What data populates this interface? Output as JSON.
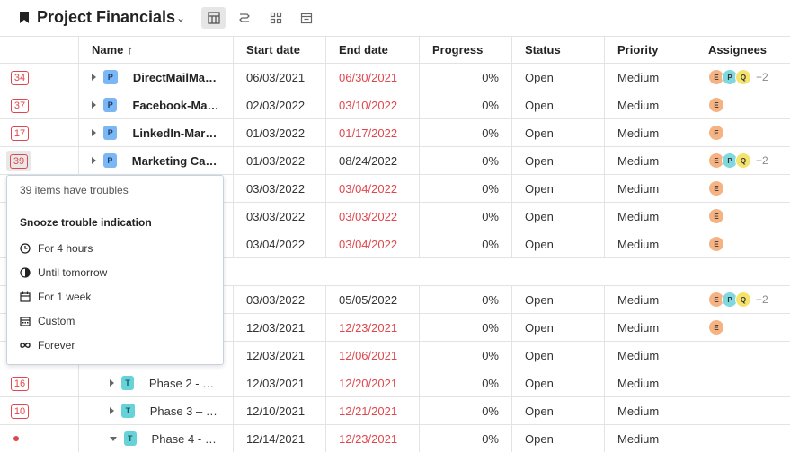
{
  "header": {
    "title": "Project Financials"
  },
  "columns": {
    "name": "Name",
    "start": "Start date",
    "end": "End date",
    "progress": "Progress",
    "status": "Status",
    "priority": "Priority",
    "assignees": "Assignees"
  },
  "rows": [
    {
      "trouble": "34",
      "name": "DirectMailMar…",
      "tag": "P",
      "start": "06/03/2021",
      "end": "06/30/2021",
      "progress": "0%",
      "status": "Open",
      "priority": "Medium",
      "assignees": [
        "E",
        "P",
        "Q"
      ],
      "more": "+2"
    },
    {
      "trouble": "37",
      "name": "Facebook-Mar…",
      "tag": "P",
      "start": "02/03/2022",
      "end": "03/10/2022",
      "progress": "0%",
      "status": "Open",
      "priority": "Medium",
      "assignees": [
        "E"
      ],
      "more": ""
    },
    {
      "trouble": "17",
      "name": "LinkedIn-Mark…",
      "tag": "P",
      "start": "01/03/2022",
      "end": "01/17/2022",
      "progress": "0%",
      "status": "Open",
      "priority": "Medium",
      "assignees": [
        "E"
      ],
      "more": ""
    },
    {
      "trouble": "39",
      "name": "Marketing Cam…",
      "tag": "P",
      "start": "01/03/2022",
      "end": "08/24/2022",
      "progress": "0%",
      "status": "Open",
      "priority": "Medium",
      "assignees": [
        "E",
        "P",
        "Q"
      ],
      "more": "+2"
    },
    {
      "trouble": "",
      "name": "",
      "tag": "",
      "start": "03/03/2022",
      "end": "03/04/2022",
      "progress": "0%",
      "status": "Open",
      "priority": "Medium",
      "assignees": [
        "E"
      ],
      "more": ""
    },
    {
      "trouble": "",
      "name": "",
      "tag": "",
      "start": "03/03/2022",
      "end": "03/03/2022",
      "progress": "0%",
      "status": "Open",
      "priority": "Medium",
      "assignees": [
        "E"
      ],
      "more": ""
    },
    {
      "trouble": "",
      "name": "",
      "tag": "",
      "start": "03/04/2022",
      "end": "03/04/2022",
      "progress": "0%",
      "status": "Open",
      "priority": "Medium",
      "assignees": [
        "E"
      ],
      "more": ""
    },
    {
      "trouble": "",
      "name": "",
      "tag": "",
      "start": "03/03/2022",
      "end": "05/05/2022",
      "progress": "0%",
      "status": "Open",
      "priority": "Medium",
      "assignees": [
        "E",
        "P",
        "Q"
      ],
      "more": "+2"
    },
    {
      "trouble": "",
      "name": "",
      "tag": "",
      "start": "12/03/2021",
      "end": "12/23/2021",
      "progress": "0%",
      "status": "Open",
      "priority": "Medium",
      "assignees": [
        "E"
      ],
      "more": ""
    },
    {
      "trouble": "",
      "name": "",
      "tag": "",
      "start": "12/03/2021",
      "end": "12/06/2021",
      "progress": "0%",
      "status": "Open",
      "priority": "Medium",
      "assignees": [],
      "more": ""
    },
    {
      "trouble": "16",
      "name": "Phase 2 - Bui…",
      "tag": "T",
      "start": "12/03/2021",
      "end": "12/20/2021",
      "progress": "0%",
      "status": "Open",
      "priority": "Medium",
      "assignees": [],
      "more": ""
    },
    {
      "trouble": "10",
      "name": "Phase 3 – O…",
      "tag": "T",
      "start": "12/10/2021",
      "end": "12/21/2021",
      "progress": "0%",
      "status": "Open",
      "priority": "Medium",
      "assignees": [],
      "more": ""
    },
    {
      "trouble": "",
      "name": "Phase 4 - Mo…",
      "tag": "T",
      "start": "12/14/2021",
      "end": "12/23/2021",
      "progress": "0%",
      "status": "Open",
      "priority": "Medium",
      "assignees": [],
      "more": ""
    }
  ],
  "popup": {
    "title": "39 items have troubles",
    "heading": "Snooze trouble indication",
    "options": [
      "For 4 hours",
      "Until tomorrow",
      "For 1 week",
      "Custom",
      "Forever"
    ]
  },
  "colors": {
    "overdue": "#e0474c",
    "project_tag": "#7cb7f5",
    "task_tag": "#67d2d8"
  }
}
